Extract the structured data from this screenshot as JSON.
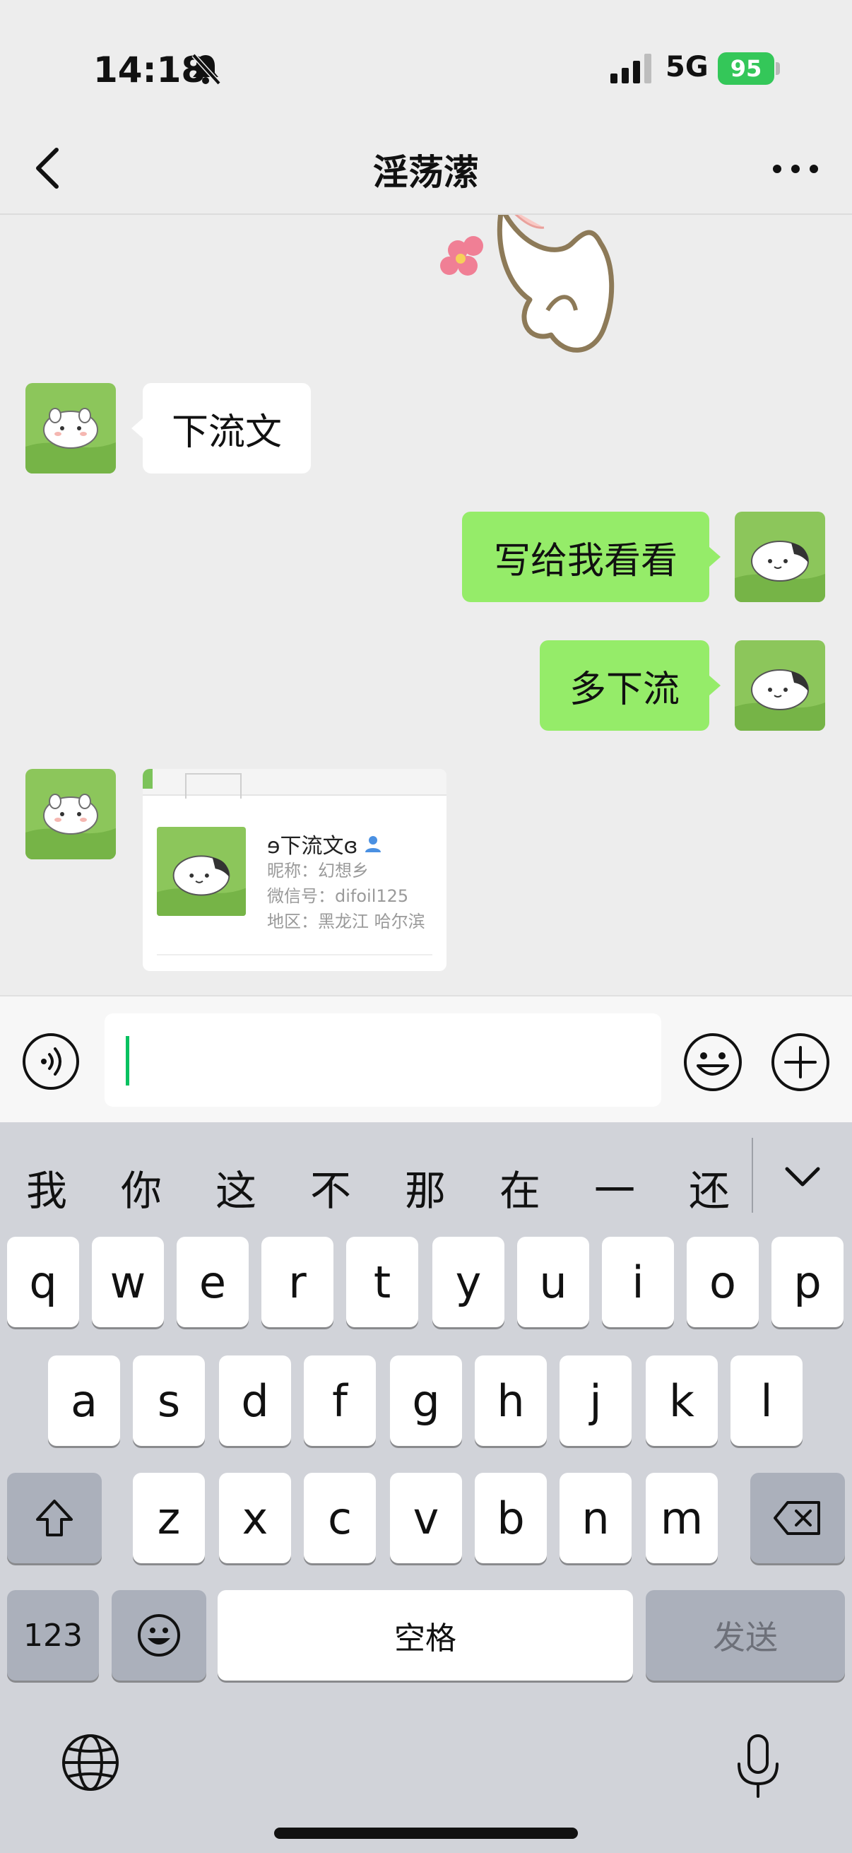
{
  "status": {
    "time": "14:18",
    "network": "5G",
    "battery": "95"
  },
  "nav": {
    "title": "淫荡潆"
  },
  "messages": {
    "m1": "下流文",
    "m2": "写给我看看",
    "m3": "多下流"
  },
  "contact_card": {
    "name": "ɘ下流文ɞ",
    "nickname": "昵称：幻想乡",
    "wechat_id": "微信号：difoil125",
    "region": "地区：黑龙江 哈尔滨"
  },
  "input": {
    "value": ""
  },
  "keyboard": {
    "candidates": [
      "我",
      "你",
      "这",
      "不",
      "那",
      "在",
      "一",
      "还"
    ],
    "row1": [
      "q",
      "w",
      "e",
      "r",
      "t",
      "y",
      "u",
      "i",
      "o",
      "p"
    ],
    "row2": [
      "a",
      "s",
      "d",
      "f",
      "g",
      "h",
      "j",
      "k",
      "l"
    ],
    "row3": [
      "z",
      "x",
      "c",
      "v",
      "b",
      "n",
      "m"
    ],
    "numbers_key": "123",
    "space_key": "空格",
    "send_key": "发送"
  },
  "colors": {
    "background": "#ededed",
    "own_bubble": "#95ec69",
    "battery": "#34c759",
    "caret": "#07c160"
  }
}
